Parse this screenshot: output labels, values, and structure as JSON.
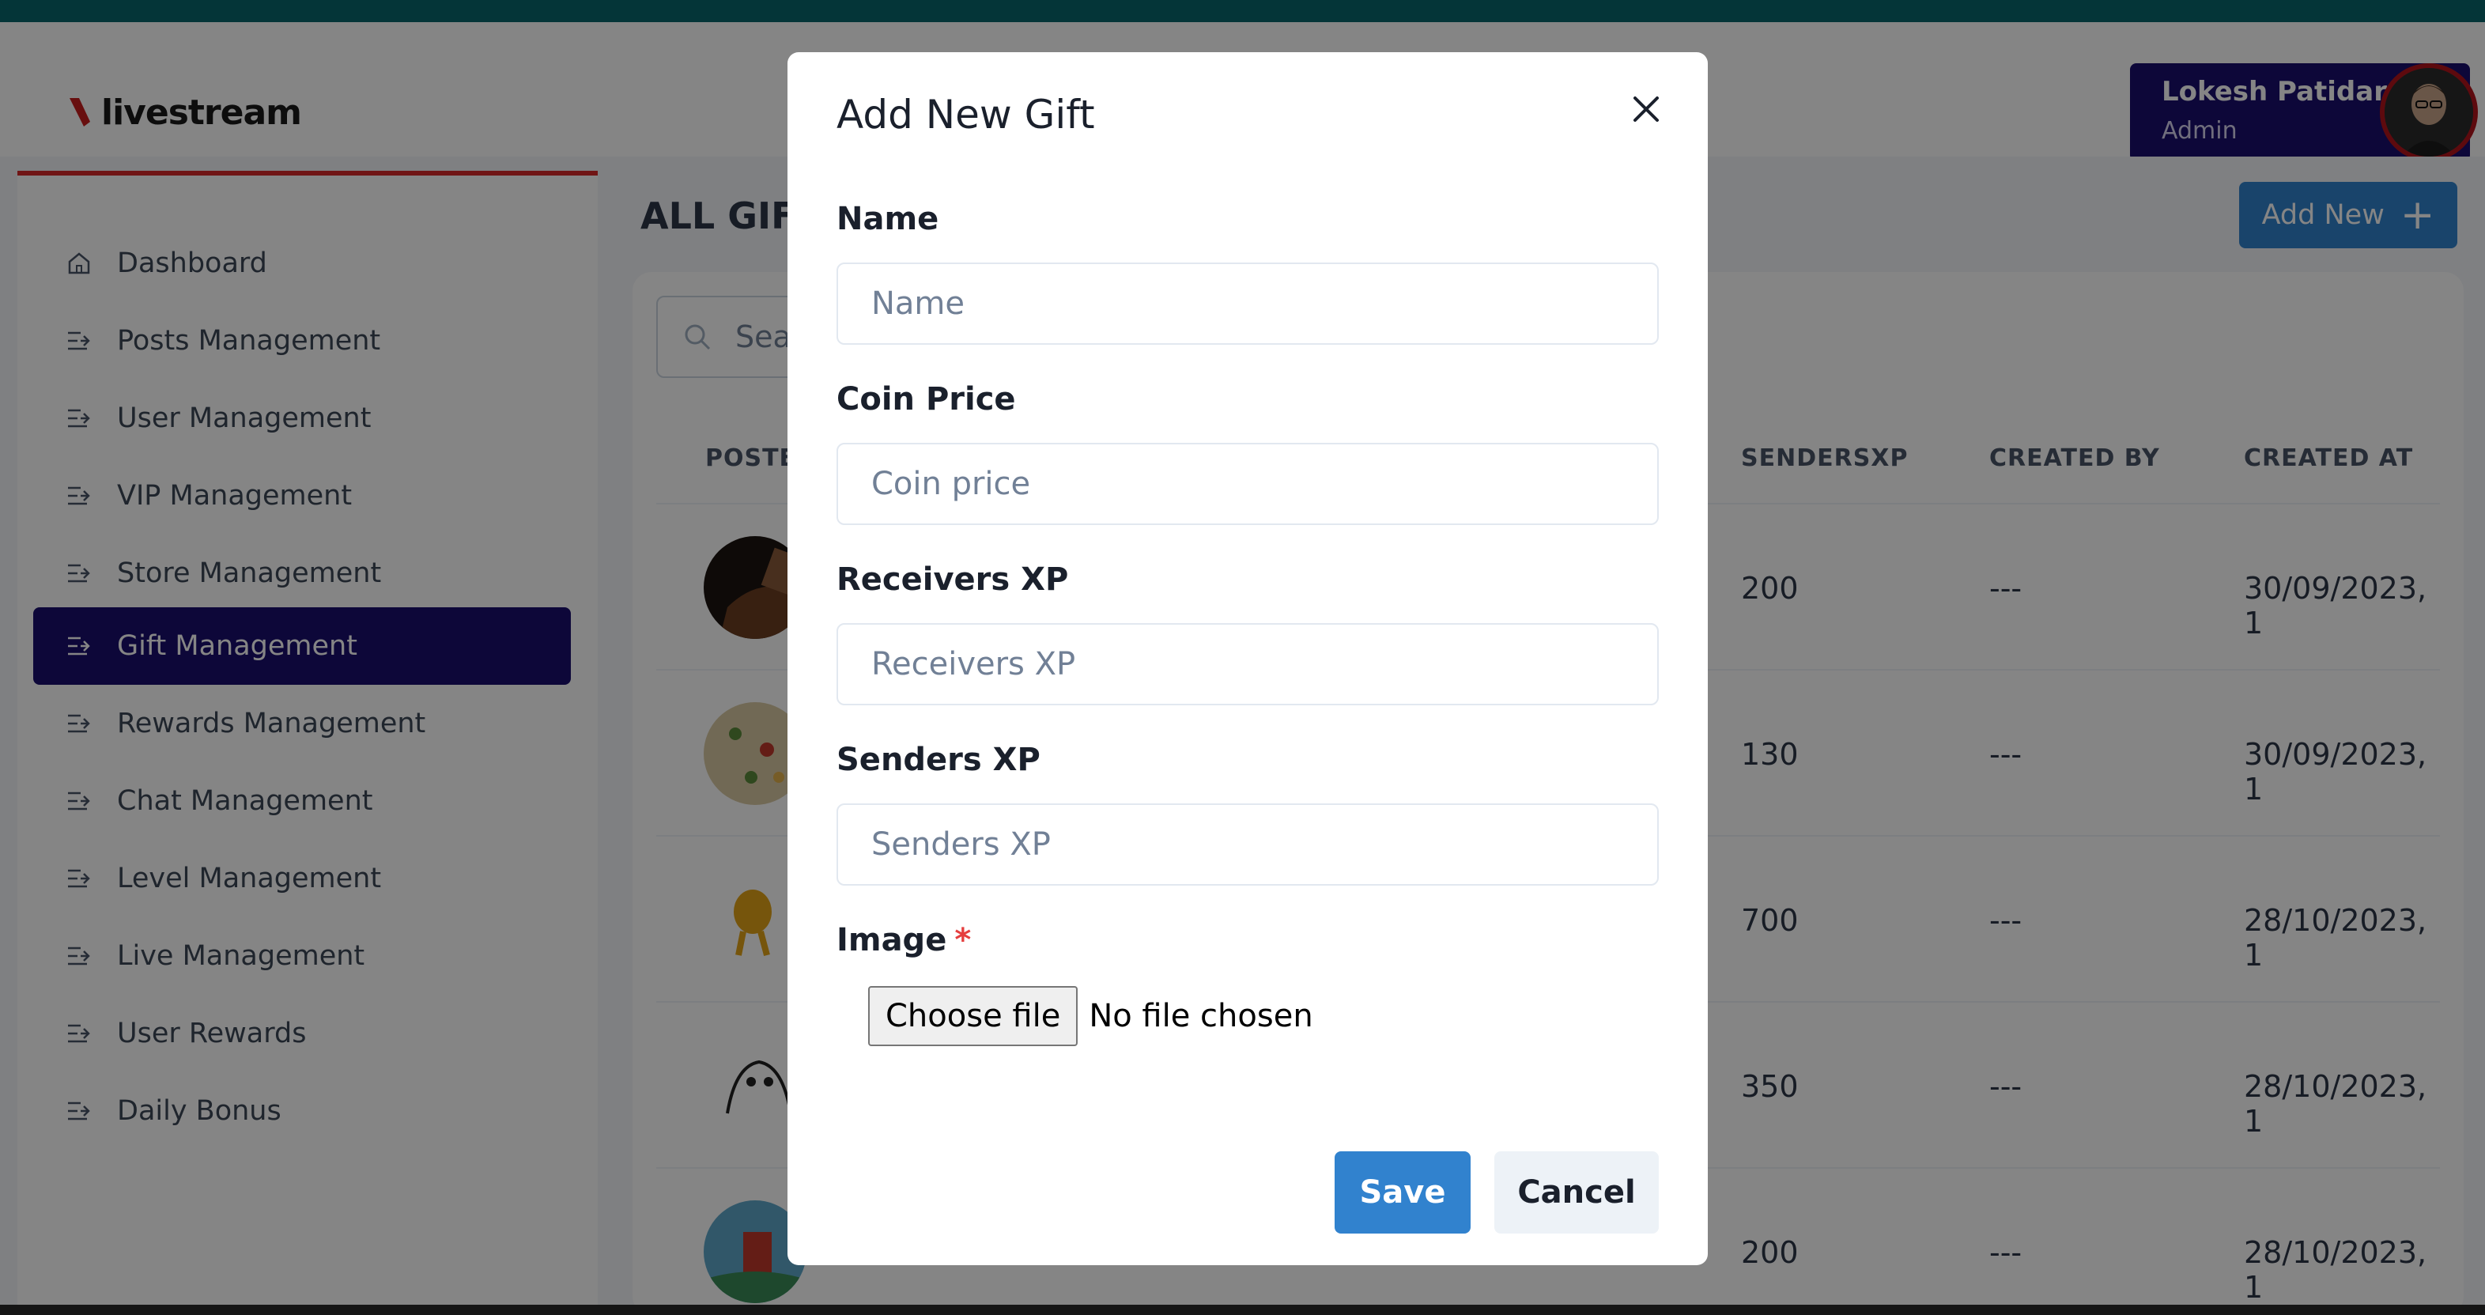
{
  "app": {
    "logo_text": "livestream"
  },
  "user": {
    "name": "Lokesh Patidar",
    "role": "Admin"
  },
  "sidebar": {
    "items": [
      {
        "label": "Dashboard",
        "icon": "home-icon"
      },
      {
        "label": "Posts Management",
        "icon": "list-arrow-icon"
      },
      {
        "label": "User Management",
        "icon": "list-arrow-icon"
      },
      {
        "label": "VIP Management",
        "icon": "list-arrow-icon"
      },
      {
        "label": "Store Management",
        "icon": "list-arrow-icon"
      },
      {
        "label": "Gift Management",
        "icon": "list-arrow-icon",
        "active": true
      },
      {
        "label": "Rewards Management",
        "icon": "list-arrow-icon"
      },
      {
        "label": "Chat Management",
        "icon": "list-arrow-icon"
      },
      {
        "label": "Level Management",
        "icon": "list-arrow-icon"
      },
      {
        "label": "Live Management",
        "icon": "list-arrow-icon"
      },
      {
        "label": "User Rewards",
        "icon": "list-arrow-icon"
      },
      {
        "label": "Daily Bonus",
        "icon": "list-arrow-icon"
      }
    ]
  },
  "main": {
    "title_visible": "ALL GIF",
    "add_new_label": "Add New",
    "search_placeholder_visible": "Sea",
    "table": {
      "headers": {
        "poster_visible": "POSTE",
        "sendersxp": "SENDERSXP",
        "created_by": "CREATED BY",
        "created_at": "CREATED AT"
      },
      "rows": [
        {
          "sendersxp": "200",
          "created_by": "---",
          "created_at": "30/09/2023, 1"
        },
        {
          "sendersxp": "130",
          "created_by": "---",
          "created_at": "30/09/2023, 1"
        },
        {
          "sendersxp": "700",
          "created_by": "---",
          "created_at": "28/10/2023, 1"
        },
        {
          "sendersxp": "350",
          "created_by": "---",
          "created_at": "28/10/2023, 1"
        },
        {
          "sendersxp": "200",
          "created_by": "---",
          "created_at": "28/10/2023, 1"
        }
      ]
    }
  },
  "modal": {
    "title": "Add New Gift",
    "fields": {
      "name": {
        "label": "Name",
        "placeholder": "Name",
        "value": ""
      },
      "coin_price": {
        "label": "Coin Price",
        "placeholder": "Coin price",
        "value": ""
      },
      "receivers_xp": {
        "label": "Receivers XP",
        "placeholder": "Receivers XP",
        "value": ""
      },
      "senders_xp": {
        "label": "Senders XP",
        "placeholder": "Senders XP",
        "value": ""
      },
      "image": {
        "label": "Image",
        "required_mark": "*",
        "button_label": "Choose file",
        "status": "No file chosen"
      }
    },
    "save_label": "Save",
    "cancel_label": "Cancel"
  },
  "colors": {
    "brand_navy": "#1a0f6e",
    "primary_blue": "#3182ce",
    "accent_red": "#d62a2a",
    "top_strip": "#08666b"
  }
}
